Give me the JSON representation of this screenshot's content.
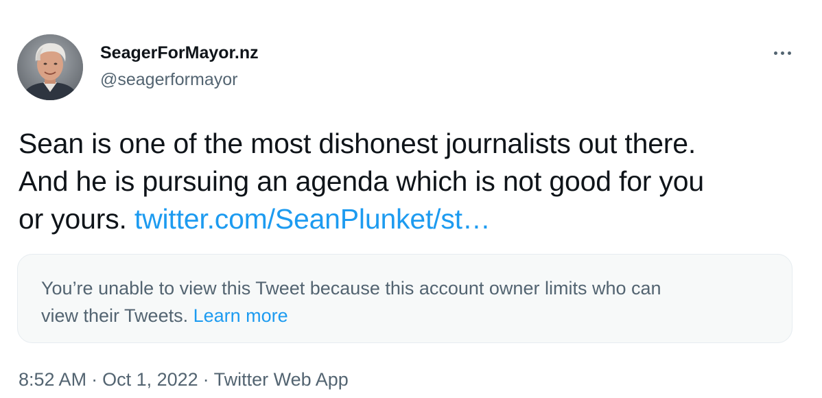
{
  "author": {
    "display_name": "SeagerForMayor.nz",
    "handle": "@seagerformayor",
    "avatar_icon": "user-avatar-photo"
  },
  "menu": {
    "icon": "more-options-icon"
  },
  "tweet": {
    "text_lines": [
      "Sean is one of the most dishonest journalists out there.",
      "And he is pursuing an agenda which is not good for you",
      "or yours."
    ],
    "link_text": "twitter.com/SeanPlunket/st…"
  },
  "quoted": {
    "message_lines": [
      "You’re unable to view this Tweet because this account owner limits who can",
      "view their Tweets."
    ],
    "learn_more": "Learn more"
  },
  "meta": {
    "time": "8:52 AM",
    "separator": "·",
    "date": "Oct 1, 2022",
    "source": "Twitter Web App"
  },
  "colors": {
    "link": "#1d9bf0",
    "secondary_text": "#536471",
    "primary_text": "#0f1419",
    "card_background": "#f7f9f9"
  }
}
